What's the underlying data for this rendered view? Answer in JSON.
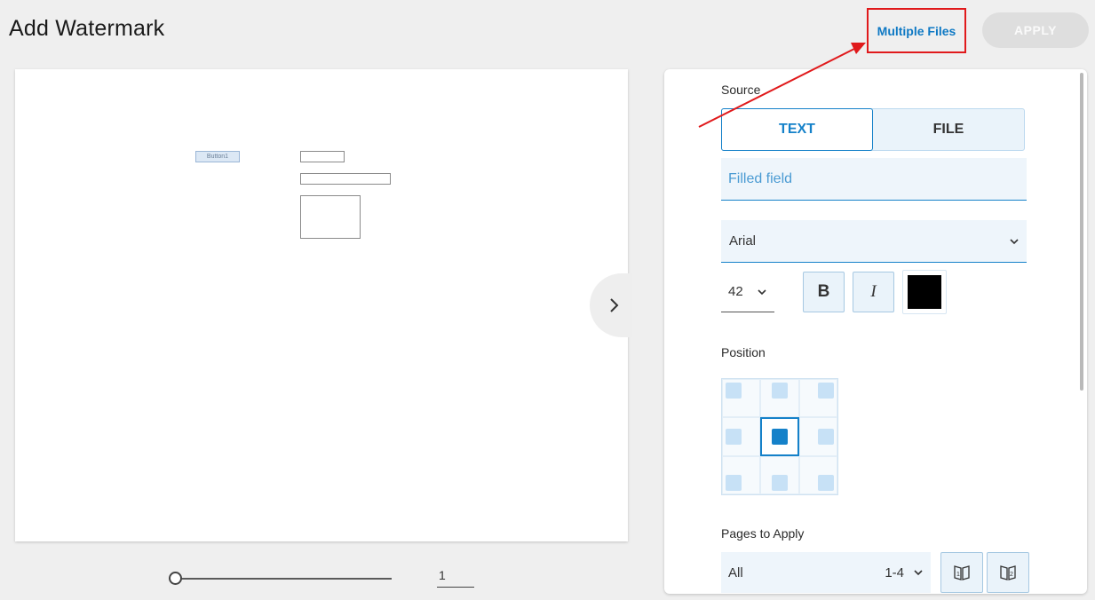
{
  "header": {
    "title": "Add Watermark",
    "multiple_files_label": "Multiple Files",
    "apply_label": "APPLY"
  },
  "preview": {
    "button_label": "Button1",
    "page_number": "1"
  },
  "settings": {
    "source_label": "Source",
    "source_options": [
      "TEXT",
      "FILE"
    ],
    "source_selected": "TEXT",
    "text_value": "Filled field",
    "font_value": "Arial",
    "font_size_value": "42",
    "bold_label": "B",
    "italic_label": "I",
    "color": "#000000",
    "position_label": "Position",
    "position_selected": "middle-center",
    "pages_label": "Pages to Apply",
    "pages_value": "All",
    "pages_range": "1-4"
  },
  "colors": {
    "accent": "#1581c9",
    "annotation": "#e0191b"
  }
}
